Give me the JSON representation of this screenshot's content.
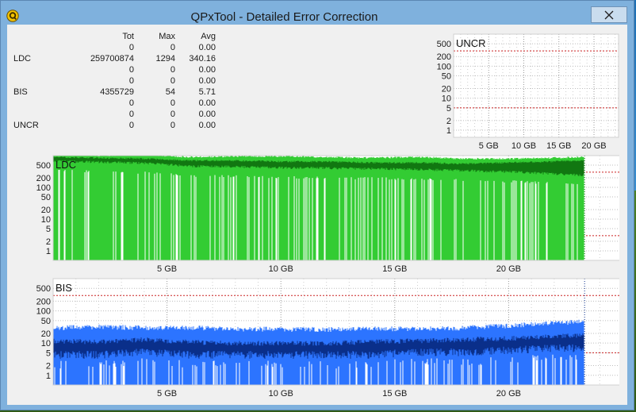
{
  "window": {
    "title": "QPxTool - Detailed Error Correction"
  },
  "stats": {
    "headers": [
      "",
      "Tot",
      "Max",
      "Avg"
    ],
    "rows": [
      [
        "",
        "0",
        "0",
        "0.00"
      ],
      [
        "LDC",
        "259700874",
        "1294",
        "340.16"
      ],
      [
        "",
        "0",
        "0",
        "0.00"
      ],
      [
        "",
        "0",
        "0",
        "0.00"
      ],
      [
        "BIS",
        "4355729",
        "54",
        "5.71"
      ],
      [
        "",
        "0",
        "0",
        "0.00"
      ],
      [
        "",
        "0",
        "0",
        "0.00"
      ],
      [
        "UNCR",
        "0",
        "0",
        "0.00"
      ]
    ]
  },
  "colors": {
    "ldc_light": "#33cc33",
    "ldc_dark": "#117711",
    "bis_light": "#2c74ff",
    "bis_dark": "#0a2f8a",
    "threshold": "#cc2222",
    "grid": "#aaaaaa"
  },
  "chart_data": [
    {
      "type": "area",
      "title": "UNCR",
      "yscale": "log",
      "yticks": [
        1,
        2,
        5,
        10,
        20,
        50,
        100,
        200,
        500
      ],
      "xticks": [
        "5 GB",
        "10 GB",
        "15 GB",
        "20 GB"
      ],
      "xtick_values": [
        5,
        10,
        15,
        20
      ],
      "xlim": [
        0,
        23.5
      ],
      "ylim": [
        0.6,
        1000
      ],
      "thresholds": [
        5,
        300
      ],
      "series": [
        {
          "values": []
        }
      ]
    },
    {
      "type": "area",
      "title": "LDC",
      "yscale": "log",
      "yticks": [
        1,
        2,
        5,
        10,
        20,
        50,
        100,
        200,
        500
      ],
      "xticks": [
        "5 GB",
        "10 GB",
        "15 GB",
        "20 GB"
      ],
      "xtick_values": [
        5,
        10,
        15,
        20
      ],
      "xlim": [
        0,
        25
      ],
      "ylim": [
        0.5,
        1000
      ],
      "thresholds": [
        3,
        300
      ],
      "series": [
        {
          "x": [
            0,
            2,
            4,
            6,
            8,
            10,
            12,
            14,
            16,
            18,
            20,
            22,
            23.3
          ],
          "max": [
            1100,
            1000,
            1050,
            900,
            950,
            950,
            900,
            850,
            900,
            800,
            800,
            850,
            900
          ],
          "mid": [
            900,
            850,
            800,
            700,
            700,
            650,
            650,
            600,
            600,
            550,
            600,
            650,
            700
          ],
          "low": [
            700,
            650,
            600,
            480,
            460,
            430,
            420,
            400,
            380,
            350,
            320,
            280,
            250
          ]
        }
      ]
    },
    {
      "type": "area",
      "title": "BIS",
      "yscale": "log",
      "yticks": [
        1,
        2,
        5,
        10,
        20,
        50,
        100,
        200,
        500
      ],
      "xticks": [
        "5 GB",
        "10 GB",
        "15 GB",
        "20 GB"
      ],
      "xtick_values": [
        5,
        10,
        15,
        20
      ],
      "xlim": [
        0,
        25
      ],
      "ylim": [
        0.5,
        1000
      ],
      "thresholds": [
        5,
        300
      ],
      "series": [
        {
          "x": [
            0,
            2,
            4,
            6,
            8,
            10,
            12,
            14,
            16,
            18,
            20,
            22,
            23.3
          ],
          "max": [
            30,
            32,
            30,
            30,
            28,
            27,
            27,
            28,
            28,
            30,
            35,
            42,
            48
          ],
          "mid": [
            12,
            11,
            13,
            11,
            10,
            10,
            10,
            11,
            12,
            13,
            14,
            16,
            18
          ],
          "low": [
            5,
            5,
            6,
            5,
            5,
            5,
            5,
            5,
            6,
            6,
            7,
            8,
            8
          ]
        }
      ]
    }
  ]
}
